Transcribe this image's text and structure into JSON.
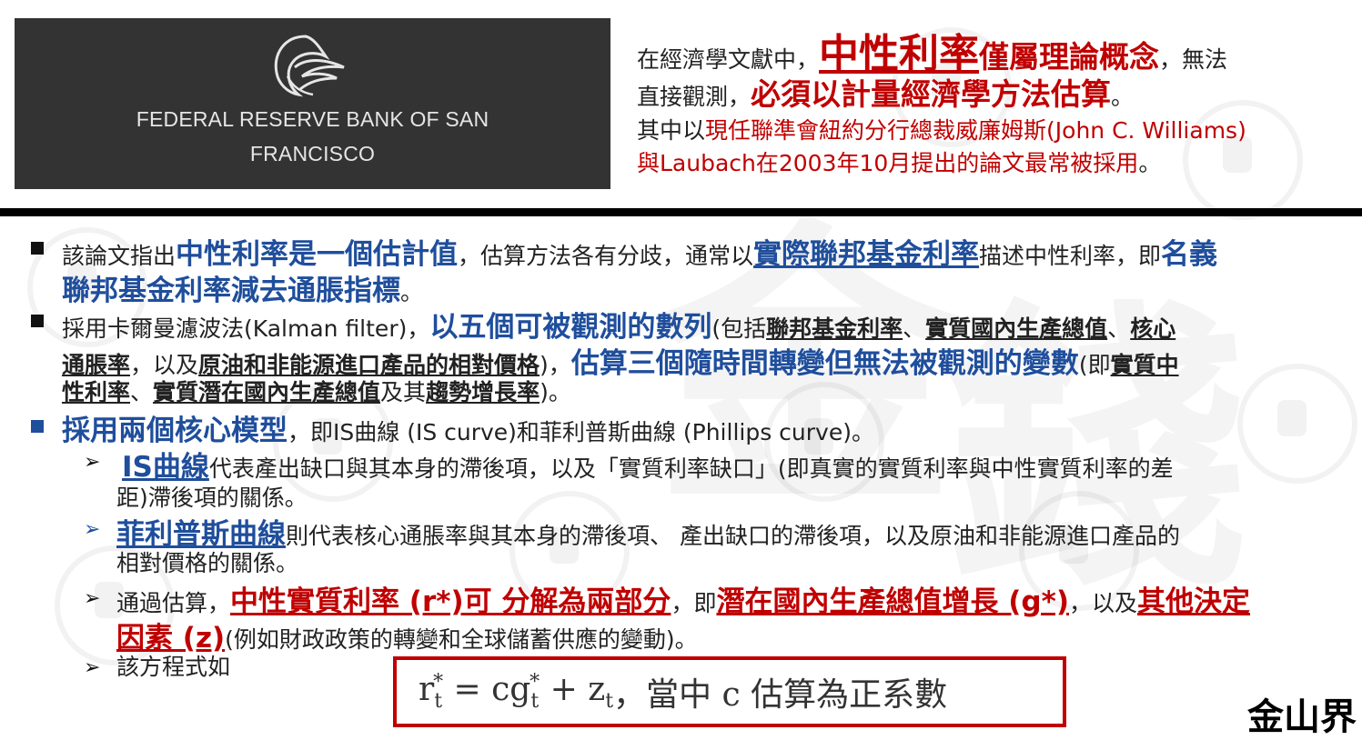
{
  "logo": {
    "name_line1": "FEDERAL RESERVE BANK OF SAN",
    "name_line2": "FRANCISCO"
  },
  "intro": {
    "l1_a": "在經濟學文獻中，",
    "l1_b": "中性利率",
    "l1_c": "僅屬理論概念",
    "l1_d": "，無法",
    "l2_a": "直接觀測，",
    "l2_b": "必須以計量經濟學方法估算",
    "l2_c": "。",
    "l3_a": "其中以",
    "l3_b": "現任聯準會紐約分行總裁威廉姆斯(John C. Williams)",
    "l4_a": "與Laubach在2003年10月提出的論文最常被採用",
    "l4_b": "。"
  },
  "points": {
    "p1_a": "該論文指出",
    "p1_b": "中性利率是一個估計值",
    "p1_c": "，估算方法各有分歧，通常以",
    "p1_d": "實際聯邦基金利率",
    "p1_e": "描述中性利率，即",
    "p1_f": "名義",
    "p1_g": "聯邦基金利率減去通脹指標",
    "p1_h": "。",
    "p2_a": "採用卡爾曼濾波法(Kalman filter)，",
    "p2_b": "以五個可被觀測的數列",
    "p2_c": "(包括",
    "p2_d": "聯邦基金利率",
    "p2_e": "、",
    "p2_f": "實質國內生產總值",
    "p2_g": "、",
    "p2_h": "核心",
    "p2_i": "通脹率",
    "p2_j": "，以及",
    "p2_k": "原油和非能源進口產品的相對價格",
    "p2_l": ")，",
    "p2_m": "估算三個隨時間轉變但無法被觀測的變數",
    "p2_n": "(即",
    "p2_o": "實質中",
    "p2_p": "性利率",
    "p2_q": "、",
    "p2_r": "實質潛在國內生產總值",
    "p2_s": "及其",
    "p2_t": "趨勢增長率",
    "p2_u": ")。",
    "p3_a": "採用兩個核心模型",
    "p3_b": "，即IS曲線 (IS curve)和菲利普斯曲線 (Phillips curve)。",
    "s1_a": "IS曲線",
    "s1_b": "代表產出缺口與其本身的滯後項，以及「實質利率缺口」(即真實的實質利率與中性實質利率的差",
    "s1_c": "距)滯後項的關係。",
    "s2_a": "菲利普斯曲線",
    "s2_b": "則代表核心通脹率與其本身的滯後項、 產出缺口的滯後項，以及原油和非能源進口產品的",
    "s2_c": "相對價格的關係。",
    "s3_a": "通過估算，",
    "s3_b": "中性實質利率 (r*)可 分解為兩部分",
    "s3_c": "，即",
    "s3_d": "潛在國內生產總值增長 (g*)",
    "s3_e": "，以及",
    "s3_f": "其他決定",
    "s3_g": "因素 (z)",
    "s3_h": "(例如財政政策的轉變和全球儲蓄供應的變動)。",
    "s4_a": "該方程式如"
  },
  "equation": {
    "text": "，當中 c 估算為正系數"
  },
  "corner": "金山界",
  "colors": {
    "red": "#c00000",
    "blue": "#1f4e9c",
    "logo_bg": "#333333"
  }
}
